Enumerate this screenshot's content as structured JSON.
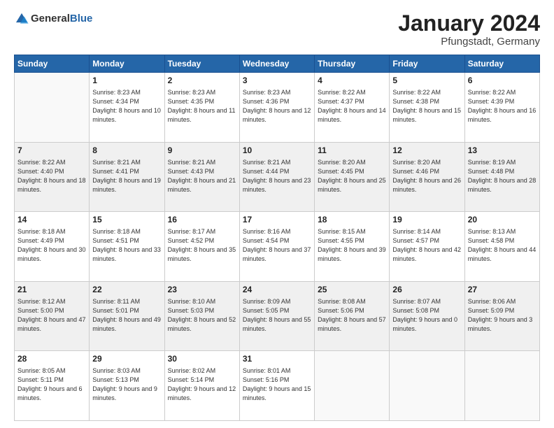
{
  "header": {
    "logo_general": "General",
    "logo_blue": "Blue",
    "title": "January 2024",
    "location": "Pfungstadt, Germany"
  },
  "weekdays": [
    "Sunday",
    "Monday",
    "Tuesday",
    "Wednesday",
    "Thursday",
    "Friday",
    "Saturday"
  ],
  "weeks": [
    [
      {
        "day": "",
        "empty": true
      },
      {
        "day": "1",
        "sunrise": "Sunrise: 8:23 AM",
        "sunset": "Sunset: 4:34 PM",
        "daylight": "Daylight: 8 hours and 10 minutes."
      },
      {
        "day": "2",
        "sunrise": "Sunrise: 8:23 AM",
        "sunset": "Sunset: 4:35 PM",
        "daylight": "Daylight: 8 hours and 11 minutes."
      },
      {
        "day": "3",
        "sunrise": "Sunrise: 8:23 AM",
        "sunset": "Sunset: 4:36 PM",
        "daylight": "Daylight: 8 hours and 12 minutes."
      },
      {
        "day": "4",
        "sunrise": "Sunrise: 8:22 AM",
        "sunset": "Sunset: 4:37 PM",
        "daylight": "Daylight: 8 hours and 14 minutes."
      },
      {
        "day": "5",
        "sunrise": "Sunrise: 8:22 AM",
        "sunset": "Sunset: 4:38 PM",
        "daylight": "Daylight: 8 hours and 15 minutes."
      },
      {
        "day": "6",
        "sunrise": "Sunrise: 8:22 AM",
        "sunset": "Sunset: 4:39 PM",
        "daylight": "Daylight: 8 hours and 16 minutes."
      }
    ],
    [
      {
        "day": "7",
        "sunrise": "Sunrise: 8:22 AM",
        "sunset": "Sunset: 4:40 PM",
        "daylight": "Daylight: 8 hours and 18 minutes."
      },
      {
        "day": "8",
        "sunrise": "Sunrise: 8:21 AM",
        "sunset": "Sunset: 4:41 PM",
        "daylight": "Daylight: 8 hours and 19 minutes."
      },
      {
        "day": "9",
        "sunrise": "Sunrise: 8:21 AM",
        "sunset": "Sunset: 4:43 PM",
        "daylight": "Daylight: 8 hours and 21 minutes."
      },
      {
        "day": "10",
        "sunrise": "Sunrise: 8:21 AM",
        "sunset": "Sunset: 4:44 PM",
        "daylight": "Daylight: 8 hours and 23 minutes."
      },
      {
        "day": "11",
        "sunrise": "Sunrise: 8:20 AM",
        "sunset": "Sunset: 4:45 PM",
        "daylight": "Daylight: 8 hours and 25 minutes."
      },
      {
        "day": "12",
        "sunrise": "Sunrise: 8:20 AM",
        "sunset": "Sunset: 4:46 PM",
        "daylight": "Daylight: 8 hours and 26 minutes."
      },
      {
        "day": "13",
        "sunrise": "Sunrise: 8:19 AM",
        "sunset": "Sunset: 4:48 PM",
        "daylight": "Daylight: 8 hours and 28 minutes."
      }
    ],
    [
      {
        "day": "14",
        "sunrise": "Sunrise: 8:18 AM",
        "sunset": "Sunset: 4:49 PM",
        "daylight": "Daylight: 8 hours and 30 minutes."
      },
      {
        "day": "15",
        "sunrise": "Sunrise: 8:18 AM",
        "sunset": "Sunset: 4:51 PM",
        "daylight": "Daylight: 8 hours and 33 minutes."
      },
      {
        "day": "16",
        "sunrise": "Sunrise: 8:17 AM",
        "sunset": "Sunset: 4:52 PM",
        "daylight": "Daylight: 8 hours and 35 minutes."
      },
      {
        "day": "17",
        "sunrise": "Sunrise: 8:16 AM",
        "sunset": "Sunset: 4:54 PM",
        "daylight": "Daylight: 8 hours and 37 minutes."
      },
      {
        "day": "18",
        "sunrise": "Sunrise: 8:15 AM",
        "sunset": "Sunset: 4:55 PM",
        "daylight": "Daylight: 8 hours and 39 minutes."
      },
      {
        "day": "19",
        "sunrise": "Sunrise: 8:14 AM",
        "sunset": "Sunset: 4:57 PM",
        "daylight": "Daylight: 8 hours and 42 minutes."
      },
      {
        "day": "20",
        "sunrise": "Sunrise: 8:13 AM",
        "sunset": "Sunset: 4:58 PM",
        "daylight": "Daylight: 8 hours and 44 minutes."
      }
    ],
    [
      {
        "day": "21",
        "sunrise": "Sunrise: 8:12 AM",
        "sunset": "Sunset: 5:00 PM",
        "daylight": "Daylight: 8 hours and 47 minutes."
      },
      {
        "day": "22",
        "sunrise": "Sunrise: 8:11 AM",
        "sunset": "Sunset: 5:01 PM",
        "daylight": "Daylight: 8 hours and 49 minutes."
      },
      {
        "day": "23",
        "sunrise": "Sunrise: 8:10 AM",
        "sunset": "Sunset: 5:03 PM",
        "daylight": "Daylight: 8 hours and 52 minutes."
      },
      {
        "day": "24",
        "sunrise": "Sunrise: 8:09 AM",
        "sunset": "Sunset: 5:05 PM",
        "daylight": "Daylight: 8 hours and 55 minutes."
      },
      {
        "day": "25",
        "sunrise": "Sunrise: 8:08 AM",
        "sunset": "Sunset: 5:06 PM",
        "daylight": "Daylight: 8 hours and 57 minutes."
      },
      {
        "day": "26",
        "sunrise": "Sunrise: 8:07 AM",
        "sunset": "Sunset: 5:08 PM",
        "daylight": "Daylight: 9 hours and 0 minutes."
      },
      {
        "day": "27",
        "sunrise": "Sunrise: 8:06 AM",
        "sunset": "Sunset: 5:09 PM",
        "daylight": "Daylight: 9 hours and 3 minutes."
      }
    ],
    [
      {
        "day": "28",
        "sunrise": "Sunrise: 8:05 AM",
        "sunset": "Sunset: 5:11 PM",
        "daylight": "Daylight: 9 hours and 6 minutes."
      },
      {
        "day": "29",
        "sunrise": "Sunrise: 8:03 AM",
        "sunset": "Sunset: 5:13 PM",
        "daylight": "Daylight: 9 hours and 9 minutes."
      },
      {
        "day": "30",
        "sunrise": "Sunrise: 8:02 AM",
        "sunset": "Sunset: 5:14 PM",
        "daylight": "Daylight: 9 hours and 12 minutes."
      },
      {
        "day": "31",
        "sunrise": "Sunrise: 8:01 AM",
        "sunset": "Sunset: 5:16 PM",
        "daylight": "Daylight: 9 hours and 15 minutes."
      },
      {
        "day": "",
        "empty": true
      },
      {
        "day": "",
        "empty": true
      },
      {
        "day": "",
        "empty": true
      }
    ]
  ]
}
